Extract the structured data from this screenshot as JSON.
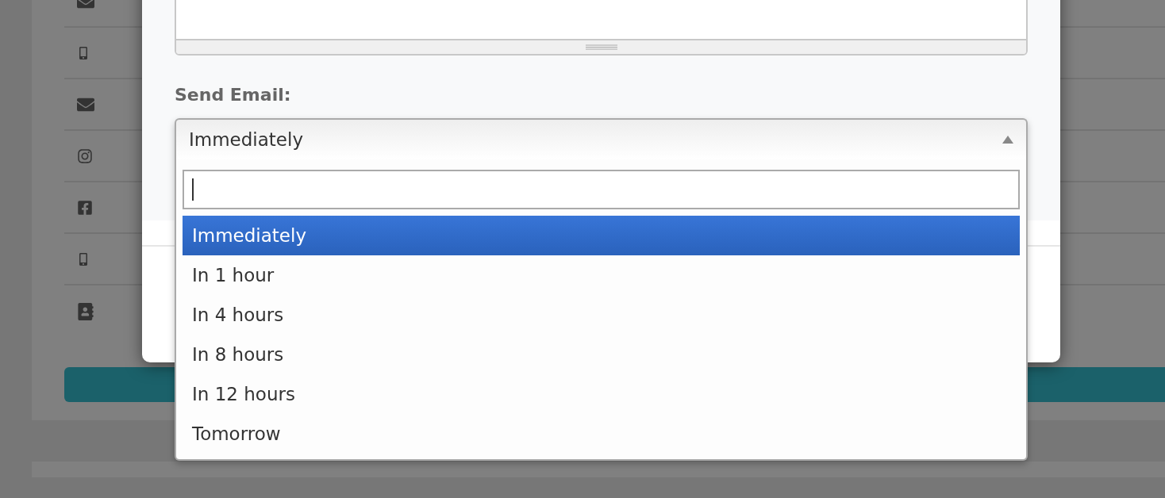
{
  "background": {
    "rows": [
      {
        "kind": "envelope"
      },
      {
        "kind": "phone"
      },
      {
        "kind": "envelope"
      },
      {
        "kind": "camera"
      },
      {
        "kind": "facebook"
      },
      {
        "kind": "phone"
      },
      {
        "kind": "contact"
      }
    ]
  },
  "dialog": {
    "field_label": "Send Email:",
    "select": {
      "value": "Immediately",
      "expanded": true,
      "options": [
        {
          "label": "Immediately",
          "selected": true
        },
        {
          "label": "In 1 hour",
          "selected": false
        },
        {
          "label": "In 4 hours",
          "selected": false
        },
        {
          "label": "In 8 hours",
          "selected": false
        },
        {
          "label": "In 12 hours",
          "selected": false
        },
        {
          "label": "Tomorrow",
          "selected": false
        }
      ]
    }
  }
}
